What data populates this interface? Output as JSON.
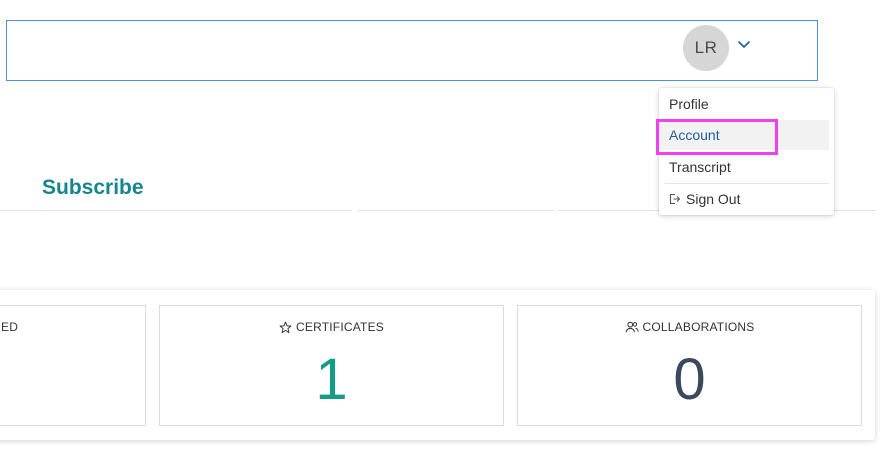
{
  "header": {
    "avatar_initials": "LR",
    "dropdown_icon": "chevron-down-icon"
  },
  "nav": {
    "subscribe_label": "Subscribe"
  },
  "user_menu": {
    "items": [
      {
        "label": "Profile"
      },
      {
        "label": "Account",
        "highlighted": true
      },
      {
        "label": "Transcript"
      },
      {
        "label": "Sign Out",
        "icon": "sign-out-icon"
      }
    ]
  },
  "stats": {
    "cards": [
      {
        "label": "ED",
        "value": ""
      },
      {
        "label": "CERTIFICATES",
        "icon": "star-icon",
        "value": "1",
        "value_color": "#179b86"
      },
      {
        "label": "COLLABORATIONS",
        "icon": "users-icon",
        "value": "0",
        "value_color": "#3a4a5c"
      }
    ]
  },
  "colors": {
    "accent": "#15858f",
    "header_border": "#4a90e2",
    "highlight": "#f23ff2",
    "active_item": "#1f5f96"
  }
}
